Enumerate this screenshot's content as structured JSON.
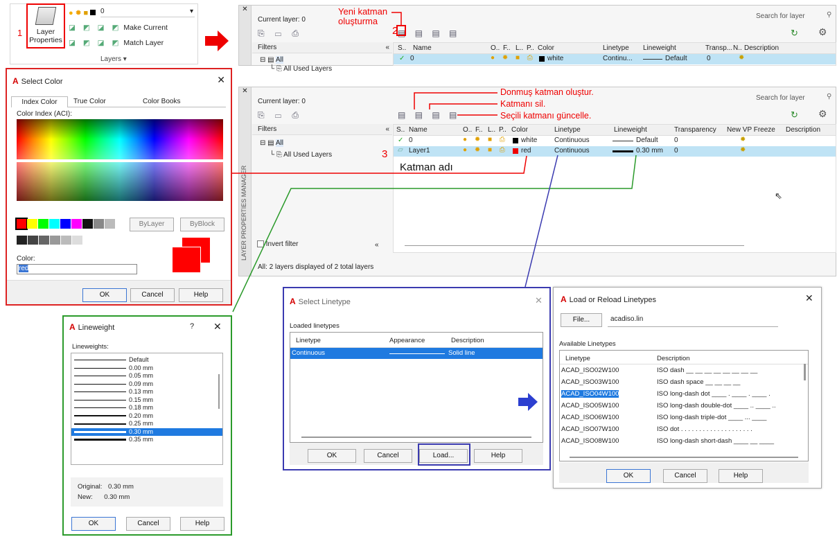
{
  "annotations": {
    "n1": "1",
    "n2": "2",
    "n3": "3",
    "new_layer": "Yeni katman\noluşturma",
    "freeze": "Donmuş katman oluştur.",
    "delete": "Katmanı sil.",
    "update": "Seçili katmanı güncelle.",
    "layer_name": "Katman adı"
  },
  "ribbon": {
    "lp_label1": "Layer",
    "lp_label2": "Properties",
    "current": "0",
    "make_current": "Make Current",
    "match_layer": "Match Layer",
    "group_label": "Layers ▾"
  },
  "mgr1": {
    "current": "Current layer: 0",
    "search": "Search for layer",
    "filters": "Filters",
    "all": "All",
    "used": "All Used Layers",
    "cols": [
      "S..",
      "Name",
      "O..",
      "F..",
      "L..",
      "P..",
      "Color",
      "Linetype",
      "Lineweight",
      "Transp...",
      "N..",
      "Description"
    ],
    "row": {
      "status": "✓",
      "name": "0",
      "color": "white",
      "linetype": "Continu...",
      "lw": "Default",
      "transp": "0"
    }
  },
  "mgr2": {
    "current": "Current layer: 0",
    "search": "Search for layer",
    "filters": "Filters",
    "all": "All",
    "used": "All Used Layers",
    "invert": "Invert filter",
    "status": "All: 2 layers displayed of 2 total layers",
    "side_label": "LAYER PROPERTIES MANAGER",
    "cols": [
      "S..",
      "Name",
      "O..",
      "F..",
      "L..",
      "P..",
      "Color",
      "Linetype",
      "Lineweight",
      "Transparency",
      "New VP Freeze",
      "Description"
    ],
    "rows": [
      {
        "status": "✓",
        "name": "0",
        "color": "white",
        "linetype": "Continuous",
        "lw": "Default",
        "transp": "0"
      },
      {
        "status": "",
        "name": "Layer1",
        "color": "red",
        "linetype": "Continuous",
        "lw": "0.30 mm",
        "transp": "0"
      }
    ]
  },
  "color_dlg": {
    "title": "Select Color",
    "tabs": [
      "Index Color",
      "True Color",
      "Color Books"
    ],
    "aci_label": "Color Index (ACI):",
    "bylayer": "ByLayer",
    "byblock": "ByBlock",
    "color_label": "Color:",
    "color_value": "red",
    "ok": "OK",
    "cancel": "Cancel",
    "help": "Help"
  },
  "lw_dlg": {
    "title": "Lineweight",
    "q": "?",
    "label": "Lineweights:",
    "items": [
      "Default",
      "0.00 mm",
      "0.05 mm",
      "0.09 mm",
      "0.13 mm",
      "0.15 mm",
      "0.18 mm",
      "0.20 mm",
      "0.25 mm",
      "0.30 mm",
      "0.35 mm"
    ],
    "original_label": "Original:",
    "original": "0.30 mm",
    "new_label": "New:",
    "new": "0.30 mm",
    "ok": "OK",
    "cancel": "Cancel",
    "help": "Help"
  },
  "lt_dlg": {
    "title": "Select Linetype",
    "loaded": "Loaded linetypes",
    "cols": [
      "Linetype",
      "Appearance",
      "Description"
    ],
    "row": {
      "name": "Continuous",
      "desc": "Solid line"
    },
    "ok": "OK",
    "cancel": "Cancel",
    "load": "Load...",
    "help": "Help"
  },
  "load_dlg": {
    "title": "Load or Reload Linetypes",
    "file_btn": "File...",
    "file": "acadiso.lin",
    "available": "Available Linetypes",
    "cols": [
      "Linetype",
      "Description"
    ],
    "items": [
      {
        "n": "ACAD_ISO02W100",
        "d": "ISO dash __ __ __ __ __ __ __ __"
      },
      {
        "n": "ACAD_ISO03W100",
        "d": "ISO dash space __   __   __   __"
      },
      {
        "n": "ACAD_ISO04W100",
        "d": "ISO long-dash dot ____ . ____ . ____ ."
      },
      {
        "n": "ACAD_ISO05W100",
        "d": "ISO long-dash double-dot ____ .. ____ .."
      },
      {
        "n": "ACAD_ISO06W100",
        "d": "ISO long-dash triple-dot ____ ... ____"
      },
      {
        "n": "ACAD_ISO07W100",
        "d": "ISO dot . . . . . . . . . . . . . . . . . . . ."
      },
      {
        "n": "ACAD_ISO08W100",
        "d": "ISO long-dash short-dash ____ __ ____"
      }
    ],
    "ok": "OK",
    "cancel": "Cancel",
    "help": "Help"
  }
}
